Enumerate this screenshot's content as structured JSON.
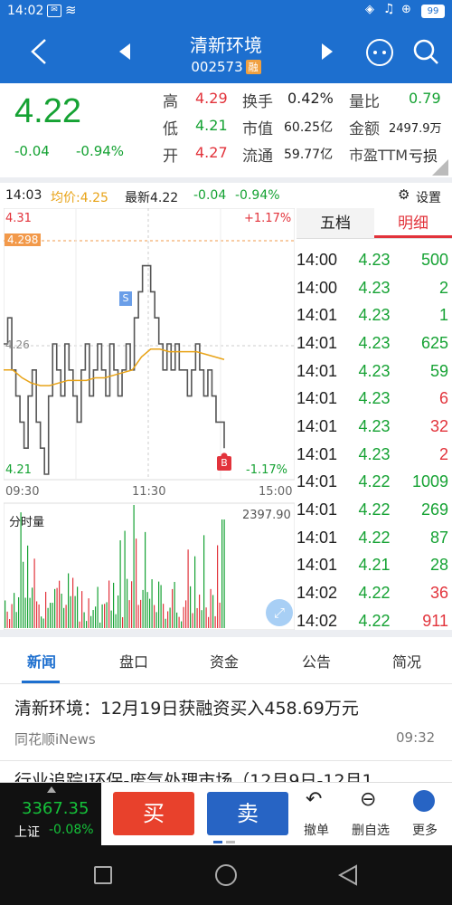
{
  "status_bar": {
    "time": "14:02",
    "battery": "99"
  },
  "nav": {
    "title": "清新环境",
    "code": "002573",
    "margin_badge": "融"
  },
  "quote": {
    "price": "4.22",
    "change": "-0.04",
    "change_pct": "-0.94%",
    "high_label": "高",
    "high": "4.29",
    "low_label": "低",
    "low": "4.21",
    "open_label": "开",
    "open": "4.27",
    "turnover_label": "换手",
    "turnover": "0.42%",
    "mktcap_label": "市值",
    "mktcap": "60.25亿",
    "float_label": "流通",
    "float_cap": "59.77亿",
    "vol_ratio_label": "量比",
    "vol_ratio": "0.79",
    "amount_label": "金额",
    "amount": "2497.9万",
    "pe_label": "市盈TTM",
    "pe": "亏损"
  },
  "timeline": {
    "time": "14:03",
    "avg_label": "均价:4.25",
    "latest_label": "最新4.22",
    "chg": "-0.04",
    "chg_pct": "-0.94%",
    "settings_label": "设置"
  },
  "chart_data": {
    "type": "line",
    "title": "",
    "price_axis": {
      "high": "4.31",
      "low": "4.21",
      "mid": "4.26",
      "ref_line": "4.298",
      "high_pct": "+1.17%",
      "low_pct": "-1.17%"
    },
    "x_labels": [
      "09:30",
      "11:30",
      "15:00"
    ],
    "ylim": [
      4.21,
      4.31
    ],
    "series": [
      {
        "name": "",
        "values": [
          4.26,
          4.27,
          4.25,
          4.24,
          4.23,
          4.22,
          4.24,
          4.25,
          4.23,
          4.22,
          4.21,
          4.24,
          4.26,
          4.25,
          4.24,
          4.26,
          4.25,
          4.24,
          4.23,
          4.25,
          4.26,
          4.24,
          4.25,
          4.26,
          4.25,
          4.24,
          4.26,
          4.25,
          4.24,
          4.25,
          4.26,
          4.25,
          4.27,
          4.28,
          4.29,
          4.29,
          4.28,
          4.27,
          4.26,
          4.25,
          4.26,
          4.25,
          4.26,
          4.25,
          4.25,
          4.24,
          4.25,
          4.26,
          4.25,
          4.24,
          4.25,
          4.24,
          4.23,
          4.23,
          4.22
        ]
      },
      {
        "name": "",
        "values": [
          4.25,
          4.25,
          4.247,
          4.245,
          4.244,
          4.244,
          4.245,
          4.246,
          4.246,
          4.246,
          4.247,
          4.247,
          4.248,
          4.249,
          4.25,
          4.255,
          4.258,
          4.258,
          4.257,
          4.257,
          4.257,
          4.257,
          4.256,
          4.255,
          4.254
        ]
      }
    ],
    "markers": [
      {
        "label": "S",
        "at_price": 4.278
      },
      {
        "label": "B",
        "at_price": 4.217
      }
    ],
    "volume_label": "分时量",
    "volume_max": "2397.90"
  },
  "detail": {
    "tabs": [
      "五档",
      "明细"
    ],
    "rows": [
      {
        "time": "14:00",
        "price": "4.23",
        "vol": "500",
        "color": "green"
      },
      {
        "time": "14:00",
        "price": "4.23",
        "vol": "2",
        "color": "green"
      },
      {
        "time": "14:01",
        "price": "4.23",
        "vol": "1",
        "color": "green"
      },
      {
        "time": "14:01",
        "price": "4.23",
        "vol": "625",
        "color": "green"
      },
      {
        "time": "14:01",
        "price": "4.23",
        "vol": "59",
        "color": "green"
      },
      {
        "time": "14:01",
        "price": "4.23",
        "vol": "6",
        "color": "red"
      },
      {
        "time": "14:01",
        "price": "4.23",
        "vol": "32",
        "color": "red"
      },
      {
        "time": "14:01",
        "price": "4.23",
        "vol": "2",
        "color": "red"
      },
      {
        "time": "14:01",
        "price": "4.22",
        "vol": "1009",
        "color": "green"
      },
      {
        "time": "14:01",
        "price": "4.22",
        "vol": "269",
        "color": "green"
      },
      {
        "time": "14:01",
        "price": "4.22",
        "vol": "87",
        "color": "green"
      },
      {
        "time": "14:01",
        "price": "4.21",
        "vol": "28",
        "color": "green"
      },
      {
        "time": "14:02",
        "price": "4.22",
        "vol": "36",
        "color": "red"
      },
      {
        "time": "14:02",
        "price": "4.22",
        "vol": "911",
        "color": "red"
      }
    ]
  },
  "news_tabs": [
    "新闻",
    "盘口",
    "资金",
    "公告",
    "简况"
  ],
  "news": {
    "items": [
      {
        "title": "清新环境：12月19日获融资买入458.69万元",
        "source": "同花顺iNews",
        "time": "09:32"
      },
      {
        "title": "行业追踪|环保-废气处理市场（12月9日-12月1"
      }
    ]
  },
  "bottom": {
    "index_value": "3367.35",
    "index_name": "上证",
    "index_chg": "-0.08%",
    "buy_label": "买",
    "sell_label": "卖",
    "undo_label": "撤单",
    "remove_fav_label": "删自选",
    "more_label": "更多"
  },
  "colors": {
    "brand": "#1d6fcf",
    "up": "#e2333b",
    "down": "#15a233",
    "avg": "#e8a317"
  }
}
